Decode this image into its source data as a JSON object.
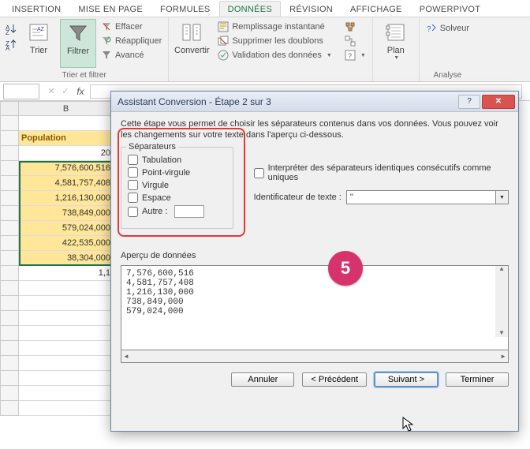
{
  "ribbon": {
    "tabs": [
      "INSERTION",
      "MISE EN PAGE",
      "FORMULES",
      "DONNÉES",
      "RÉVISION",
      "AFFICHAGE",
      "POWERPIVOT"
    ],
    "active_tab_index": 3,
    "sort_btn": "Trier",
    "filter_btn": "Filtrer",
    "clear": "Effacer",
    "reapply": "Réappliquer",
    "advanced": "Avancé",
    "group_sortfilter": "Trier et filtrer",
    "convert": "Convertir",
    "flashfill": "Remplissage instantané",
    "dedup": "Supprimer les doublons",
    "dataval": "Validation des données",
    "outline": "Plan",
    "solver": "Solveur",
    "group_analysis": "Analyse"
  },
  "formula_bar": {
    "fx": "fx"
  },
  "grid": {
    "col_header": "B",
    "data_header": "Population",
    "rows": [
      "20",
      "7,576,600,516",
      "4,581,757,408",
      "1,216,130,000",
      "738,849,000",
      "579,024,000",
      "422,535,000",
      "38,304,000",
      "1,1"
    ]
  },
  "dialog": {
    "title": "Assistant Conversion - Étape 2 sur 3",
    "desc": "Cette étape vous permet de choisir les séparateurs contenus dans vos données. Vous pouvez voir les changements sur votre texte dans l'aperçu ci-dessous.",
    "sep_legend": "Séparateurs",
    "sep": {
      "tab": "Tabulation",
      "semicolon": "Point-virgule",
      "comma": "Virgule",
      "space": "Espace",
      "other": "Autre :"
    },
    "consecutive": "Interpréter des séparateurs identiques consécutifs comme uniques",
    "textqual_label": "Identificateur de texte :",
    "textqual_value": "\"",
    "preview_label": "Aperçu de données",
    "preview_lines": [
      "7,576,600,516",
      "4,581,757,408",
      "1,216,130,000",
      "738,849,000",
      "579,024,000"
    ],
    "buttons": {
      "cancel": "Annuler",
      "back": "< Précédent",
      "next": "Suivant >",
      "finish": "Terminer"
    }
  },
  "step_badge": "5"
}
